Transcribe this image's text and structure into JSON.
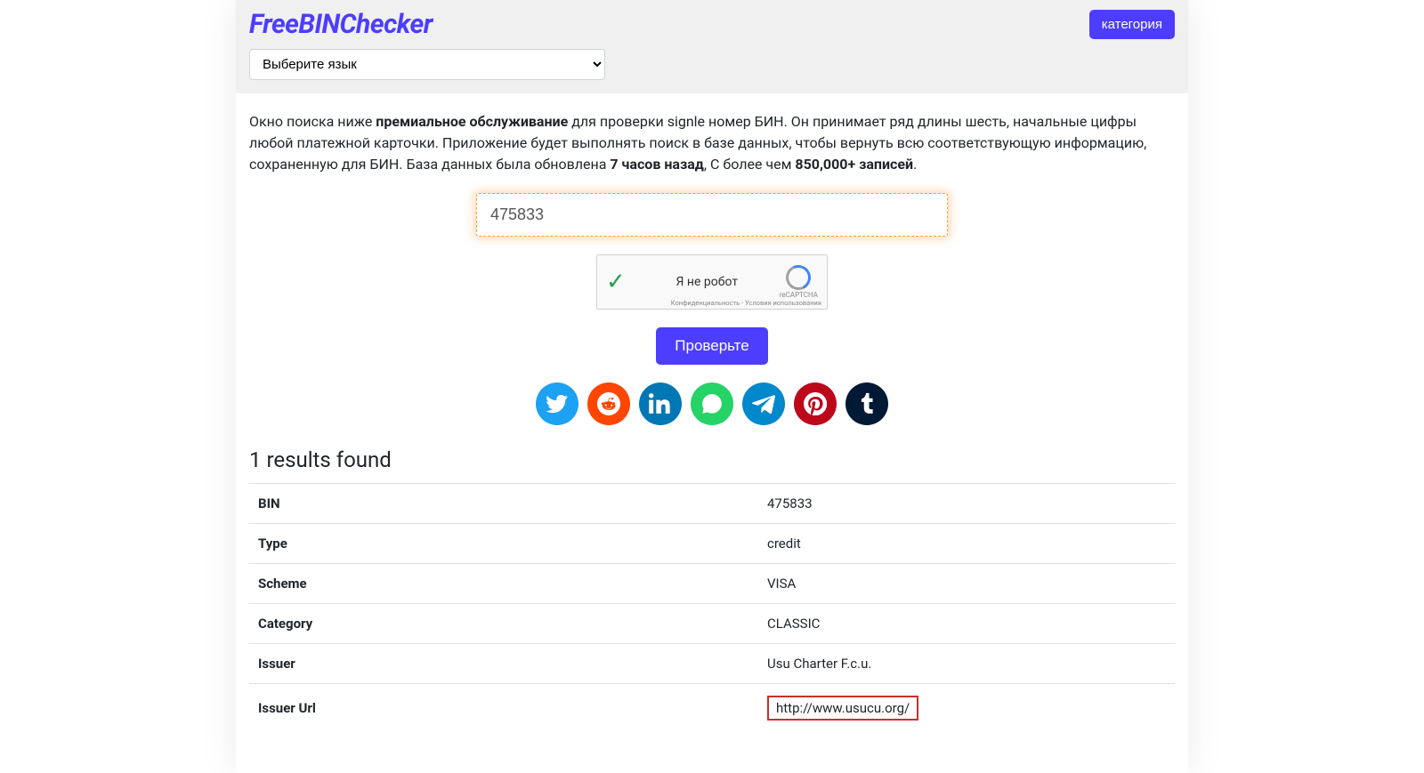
{
  "header": {
    "logo": "FreeBINChecker",
    "category_btn": "категория",
    "lang_selected": "Выберите язык"
  },
  "desc": {
    "t1": "Окно поиска ниже ",
    "b1": "премиальное обслуживание",
    "t2": " для проверки signle номер БИН. Он принимает ряд длины шесть, начальные цифры любой платежной карточки. Приложение будет выполнять поиск в базе данных, чтобы вернуть всю соответствующую информацию, сохраненную для БИН. База данных была обновлена ",
    "b2": "7 часов назад",
    "t3": ", С более чем ",
    "b3": "850,000+ записей",
    "t4": "."
  },
  "search": {
    "value": "475833",
    "check_btn": "Проверьте"
  },
  "recaptcha": {
    "label": "Я не робот",
    "brand": "reCAPTCHA",
    "footer": "Конфиденциальность - Условия использования"
  },
  "results": {
    "title": "1 results found",
    "rows": [
      {
        "label": "BIN",
        "value": "475833"
      },
      {
        "label": "Type",
        "value": "credit"
      },
      {
        "label": "Scheme",
        "value": "VISA"
      },
      {
        "label": "Category",
        "value": "CLASSIC"
      },
      {
        "label": "Issuer",
        "value": "Usu Charter F.c.u."
      },
      {
        "label": "Issuer Url",
        "value": "http://www.usucu.org/",
        "boxed": true
      }
    ]
  }
}
